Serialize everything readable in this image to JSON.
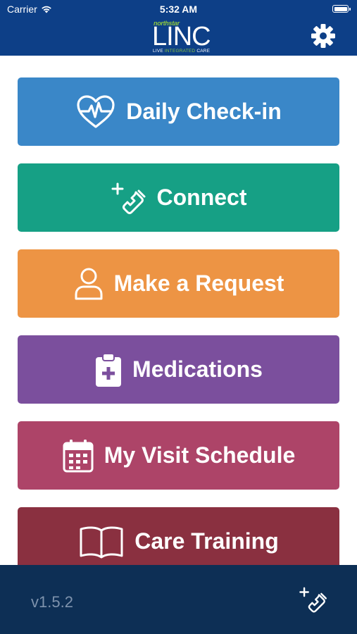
{
  "status_bar": {
    "carrier": "Carrier",
    "time": "5:32 AM"
  },
  "logo": {
    "brand_top": "northstar",
    "brand_main": "LINC",
    "tagline_a": "LIVE ",
    "tagline_b": "INTEGRATED",
    "tagline_c": " CARE"
  },
  "header": {
    "settings_icon": "gear-icon"
  },
  "menu": [
    {
      "label": "Daily Check-in",
      "icon": "heartbeat-icon",
      "color": "#3a87c8"
    },
    {
      "label": "Connect",
      "icon": "phone-plus-icon",
      "color": "#16a085"
    },
    {
      "label": "Make a Request",
      "icon": "person-icon",
      "color": "#ed9444"
    },
    {
      "label": "Medications",
      "icon": "clipboard-medical-icon",
      "color": "#7b4f9d"
    },
    {
      "label": "My Visit Schedule",
      "icon": "calendar-icon",
      "color": "#ad4468"
    },
    {
      "label": "Care Training",
      "icon": "book-icon",
      "color": "#8a3040"
    }
  ],
  "footer": {
    "version": "v1.5.2",
    "call_icon": "phone-plus-icon"
  },
  "colors": {
    "header_bg": "#0d3f87",
    "footer_bg": "#0d2f55",
    "brand_green": "#8cc63f"
  }
}
